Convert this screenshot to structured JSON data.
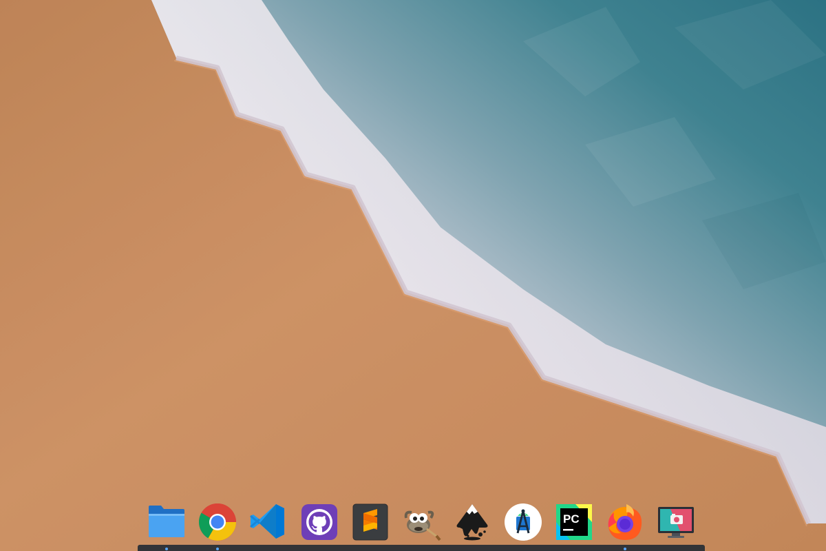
{
  "desktop": {
    "wallpaper": {
      "description_colors": {
        "sand": "#c98a5c",
        "foam": "#ece6ea",
        "water": "#2f7a8a"
      }
    }
  },
  "dock": {
    "items": [
      {
        "name": "files",
        "icon": "folder-icon",
        "running": true
      },
      {
        "name": "chrome",
        "icon": "chrome-icon",
        "running": true
      },
      {
        "name": "vscode",
        "icon": "vscode-icon",
        "running": false
      },
      {
        "name": "github-desktop",
        "icon": "github-icon",
        "running": false
      },
      {
        "name": "sublime-text",
        "icon": "sublime-text-icon",
        "running": false
      },
      {
        "name": "gimp",
        "icon": "gimp-icon",
        "running": false
      },
      {
        "name": "inkscape",
        "icon": "inkscape-icon",
        "running": false
      },
      {
        "name": "android-studio",
        "icon": "android-studio-icon",
        "running": false
      },
      {
        "name": "pycharm",
        "icon": "pycharm-icon",
        "running": false
      },
      {
        "name": "firefox",
        "icon": "firefox-icon",
        "running": true
      },
      {
        "name": "screenshot",
        "icon": "screenshot-icon",
        "running": false
      }
    ],
    "icon_texts": {
      "pycharm": "PC"
    }
  }
}
